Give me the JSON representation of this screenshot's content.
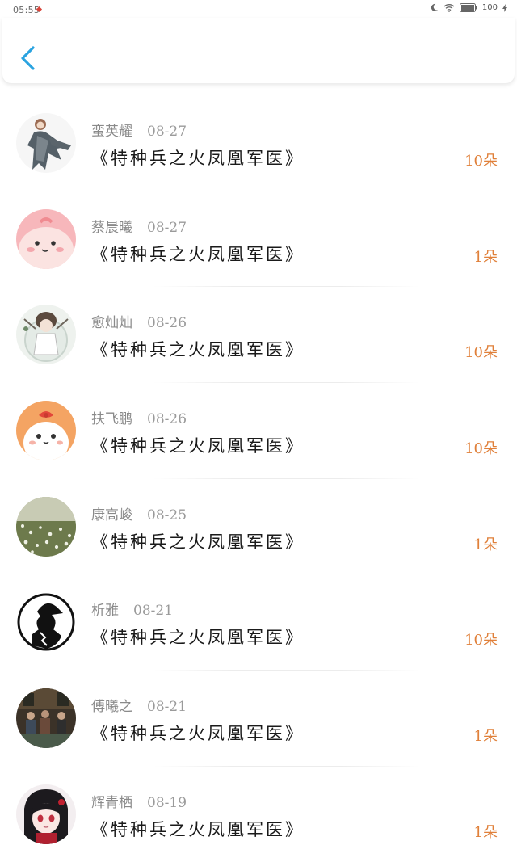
{
  "status_bar": {
    "time": "05:55",
    "battery": "100"
  },
  "header": {
    "back_icon": "chevron-left-icon"
  },
  "list": [
    {
      "name": "蛮英耀",
      "date": "08-27",
      "title": "《特种兵之火凤凰军医》",
      "amount": "10朵",
      "avatar_icon": "figure-dress-avatar"
    },
    {
      "name": "蔡晨曦",
      "date": "08-27",
      "title": "《特种兵之火凤凰军医》",
      "amount": "1朵",
      "avatar_icon": "pink-blob-avatar"
    },
    {
      "name": "愈灿灿",
      "date": "08-26",
      "title": "《特种兵之火凤凰军医》",
      "amount": "10朵",
      "avatar_icon": "globe-girl-avatar"
    },
    {
      "name": "扶飞鹏",
      "date": "08-26",
      "title": "《特种兵之火凤凰军医》",
      "amount": "10朵",
      "avatar_icon": "orange-bunny-avatar"
    },
    {
      "name": "康高峻",
      "date": "08-25",
      "title": "《特种兵之火凤凰军医》",
      "amount": "1朵",
      "avatar_icon": "flower-field-avatar"
    },
    {
      "name": "析雅",
      "date": "08-21",
      "title": "《特种兵之火凤凰军医》",
      "amount": "10朵",
      "avatar_icon": "detective-silhouette-avatar"
    },
    {
      "name": "傅曦之",
      "date": "08-21",
      "title": "《特种兵之火凤凰军医》",
      "amount": "1朵",
      "avatar_icon": "group-photo-avatar"
    },
    {
      "name": "辉青栖",
      "date": "08-19",
      "title": "《特种兵之火凤凰军医》",
      "amount": "1朵",
      "avatar_icon": "anime-girl-avatar"
    }
  ],
  "colors": {
    "accent_blue": "#2aa3e0",
    "amount_orange": "#e0803a"
  }
}
